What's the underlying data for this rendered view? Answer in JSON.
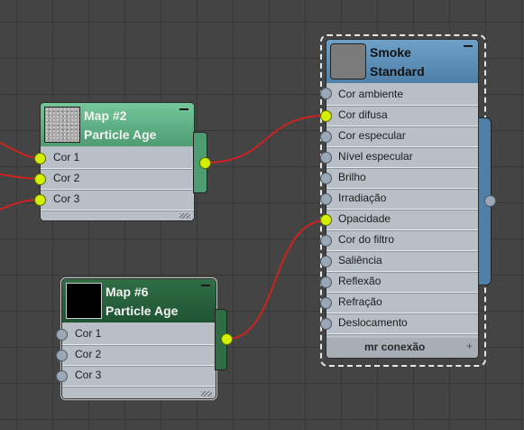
{
  "nodes": {
    "map2": {
      "title_line1": "Map #2",
      "title_line2": "Particle Age",
      "header_color": "#5fb184",
      "inputs": [
        "Cor 1",
        "Cor 2",
        "Cor 3"
      ]
    },
    "map6": {
      "title_line1": "Map #6",
      "title_line2": "Particle Age",
      "header_color": "#2a6640",
      "inputs": [
        "Cor 1",
        "Cor 2",
        "Cor 3"
      ]
    },
    "smoke": {
      "title_line1": "Smoke",
      "title_line2": "Standard",
      "header_color": "#5b8db8",
      "inputs": [
        "Cor ambiente",
        "Cor difusa",
        "Cor especular",
        "Nível especular",
        "Brilho",
        "Irradiação",
        "Opacidade",
        "Cor do filtro",
        "Saliência",
        "Reflexão",
        "Refração",
        "Deslocamento"
      ],
      "footer": "mr conexão",
      "footer_icon": "+"
    }
  },
  "colors": {
    "canvas": "#444444",
    "wire": "#cc2222",
    "port_connected": "#d4f000",
    "port_idle": "#9aa7b6"
  }
}
